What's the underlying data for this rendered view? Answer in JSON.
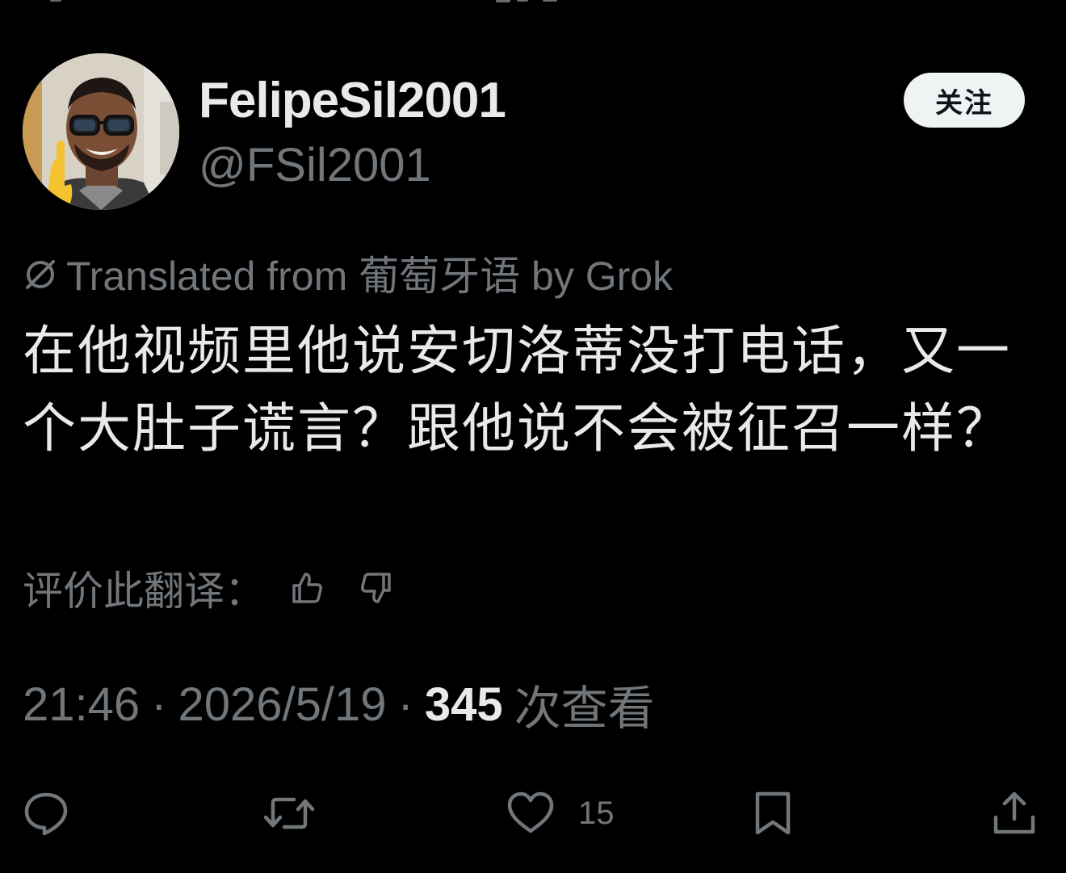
{
  "colors": {
    "background": "#000000",
    "text_primary": "#e7e9ea",
    "text_secondary": "#71767b",
    "follow_button_bg": "#eff3f4",
    "follow_button_text": "#0f1419"
  },
  "author": {
    "display_name": "FelipeSil2001",
    "handle": "@FSil2001",
    "avatar_icon": "profile-photo"
  },
  "follow_button": {
    "label": "关注"
  },
  "translation": {
    "icon": "globe-icon",
    "label": "Translated from 葡萄牙语 by Grok"
  },
  "tweet": {
    "text": "在他视频里他说安切洛蒂没打电话，又一个大肚子谎言？跟他说不会被征召一样？"
  },
  "rating": {
    "label": "评价此翻译：",
    "thumbs_up_icon": "thumbs-up-icon",
    "thumbs_down_icon": "thumbs-down-icon"
  },
  "meta": {
    "time": "21:46",
    "separator": "·",
    "date": "2026/5/19",
    "views_count": "345",
    "views_label": "次查看"
  },
  "actions": {
    "reply_icon": "reply-icon",
    "retweet_icon": "retweet-icon",
    "like_icon": "heart-icon",
    "like_count": "15",
    "bookmark_icon": "bookmark-icon",
    "share_icon": "share-icon"
  }
}
